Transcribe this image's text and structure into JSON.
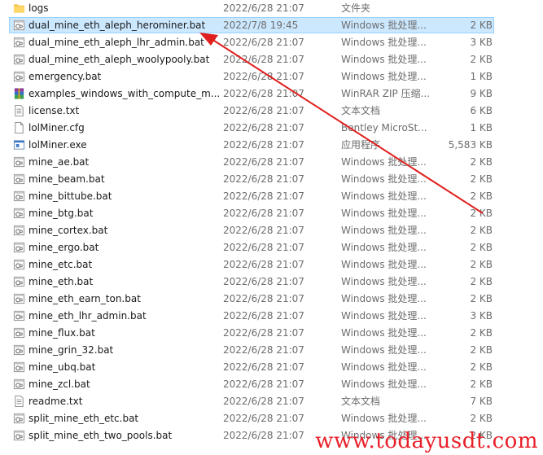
{
  "colors": {
    "selection_bg": "#cce8ff",
    "selection_border": "#99d1ff",
    "arrow": "#e0201e",
    "watermark": "#e8202a"
  },
  "files": [
    {
      "name": "logs",
      "date": "2022/6/28 21:07",
      "type": "文件夹",
      "size": "",
      "icon": "folder-icon"
    },
    {
      "name": "dual_mine_eth_aleph_herominer.bat",
      "date": "2022/7/8 19:45",
      "type": "Windows 批处理...",
      "size": "2 KB",
      "icon": "batch-file-icon",
      "selected": true
    },
    {
      "name": "dual_mine_eth_aleph_lhr_admin.bat",
      "date": "2022/6/28 21:07",
      "type": "Windows 批处理...",
      "size": "3 KB",
      "icon": "batch-file-icon"
    },
    {
      "name": "dual_mine_eth_aleph_woolypooly.bat",
      "date": "2022/6/28 21:07",
      "type": "Windows 批处理...",
      "size": "2 KB",
      "icon": "batch-file-icon"
    },
    {
      "name": "emergency.bat",
      "date": "2022/6/28 21:07",
      "type": "Windows 批处理...",
      "size": "1 KB",
      "icon": "batch-file-icon"
    },
    {
      "name": "examples_windows_with_compute_m...",
      "date": "2022/6/28 21:07",
      "type": "WinRAR ZIP 压缩...",
      "size": "9 KB",
      "icon": "winrar-archive-icon"
    },
    {
      "name": "license.txt",
      "date": "2022/6/28 21:07",
      "type": "文本文档",
      "size": "6 KB",
      "icon": "text-file-icon"
    },
    {
      "name": "lolMiner.cfg",
      "date": "2022/6/28 21:07",
      "type": "Bentley MicroSt...",
      "size": "1 KB",
      "icon": "blank-file-icon"
    },
    {
      "name": "lolMiner.exe",
      "date": "2022/6/28 21:07",
      "type": "应用程序",
      "size": "5,583 KB",
      "icon": "exe-file-icon"
    },
    {
      "name": "mine_ae.bat",
      "date": "2022/6/28 21:07",
      "type": "Windows 批处理...",
      "size": "2 KB",
      "icon": "batch-file-icon"
    },
    {
      "name": "mine_beam.bat",
      "date": "2022/6/28 21:07",
      "type": "Windows 批处理...",
      "size": "2 KB",
      "icon": "batch-file-icon"
    },
    {
      "name": "mine_bittube.bat",
      "date": "2022/6/28 21:07",
      "type": "Windows 批处理...",
      "size": "2 KB",
      "icon": "batch-file-icon"
    },
    {
      "name": "mine_btg.bat",
      "date": "2022/6/28 21:07",
      "type": "Windows 批处理...",
      "size": "2 KB",
      "icon": "batch-file-icon"
    },
    {
      "name": "mine_cortex.bat",
      "date": "2022/6/28 21:07",
      "type": "Windows 批处理...",
      "size": "2 KB",
      "icon": "batch-file-icon"
    },
    {
      "name": "mine_ergo.bat",
      "date": "2022/6/28 21:07",
      "type": "Windows 批处理...",
      "size": "2 KB",
      "icon": "batch-file-icon"
    },
    {
      "name": "mine_etc.bat",
      "date": "2022/6/28 21:07",
      "type": "Windows 批处理...",
      "size": "2 KB",
      "icon": "batch-file-icon"
    },
    {
      "name": "mine_eth.bat",
      "date": "2022/6/28 21:07",
      "type": "Windows 批处理...",
      "size": "2 KB",
      "icon": "batch-file-icon"
    },
    {
      "name": "mine_eth_earn_ton.bat",
      "date": "2022/6/28 21:07",
      "type": "Windows 批处理...",
      "size": "2 KB",
      "icon": "batch-file-icon"
    },
    {
      "name": "mine_eth_lhr_admin.bat",
      "date": "2022/6/28 21:07",
      "type": "Windows 批处理...",
      "size": "3 KB",
      "icon": "batch-file-icon"
    },
    {
      "name": "mine_flux.bat",
      "date": "2022/6/28 21:07",
      "type": "Windows 批处理...",
      "size": "2 KB",
      "icon": "batch-file-icon"
    },
    {
      "name": "mine_grin_32.bat",
      "date": "2022/6/28 21:07",
      "type": "Windows 批处理...",
      "size": "2 KB",
      "icon": "batch-file-icon"
    },
    {
      "name": "mine_ubq.bat",
      "date": "2022/6/28 21:07",
      "type": "Windows 批处理...",
      "size": "2 KB",
      "icon": "batch-file-icon"
    },
    {
      "name": "mine_zcl.bat",
      "date": "2022/6/28 21:07",
      "type": "Windows 批处理...",
      "size": "2 KB",
      "icon": "batch-file-icon"
    },
    {
      "name": "readme.txt",
      "date": "2022/6/28 21:07",
      "type": "文本文档",
      "size": "7 KB",
      "icon": "text-file-icon"
    },
    {
      "name": "split_mine_eth_etc.bat",
      "date": "2022/6/28 21:07",
      "type": "Windows 批处理...",
      "size": "2 KB",
      "icon": "batch-file-icon"
    },
    {
      "name": "split_mine_eth_two_pools.bat",
      "date": "2022/6/28 21:07",
      "type": "Windows 批处理...",
      "size": "2 KB",
      "icon": "batch-file-icon"
    }
  ],
  "annotation": {
    "icon": "red-arrow-icon"
  },
  "watermark": {
    "text": "www.todayusdt.com"
  }
}
